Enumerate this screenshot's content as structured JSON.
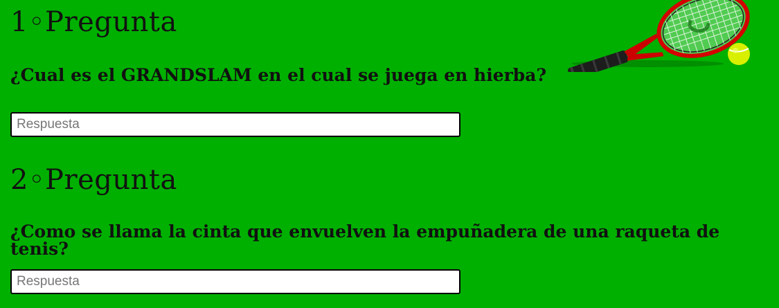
{
  "questions": [
    {
      "title": "1◦Pregunta",
      "text": "¿Cual es el GRANDSLAM en el cual se juega en hierba?",
      "input_placeholder": "Respuesta",
      "input_value": ""
    },
    {
      "title": "2◦Pregunta",
      "text": "¿Como se llama la cinta que envuelven la empuñadera de una raqueta de tenis?",
      "input_placeholder": "Respuesta",
      "input_value": ""
    }
  ],
  "colors": {
    "background": "#00b000",
    "racket_frame": "#d40000",
    "racket_handle": "#222222",
    "ball": "#d8f000"
  },
  "icons": {
    "header_image": "tennis-racket-and-ball-icon"
  }
}
